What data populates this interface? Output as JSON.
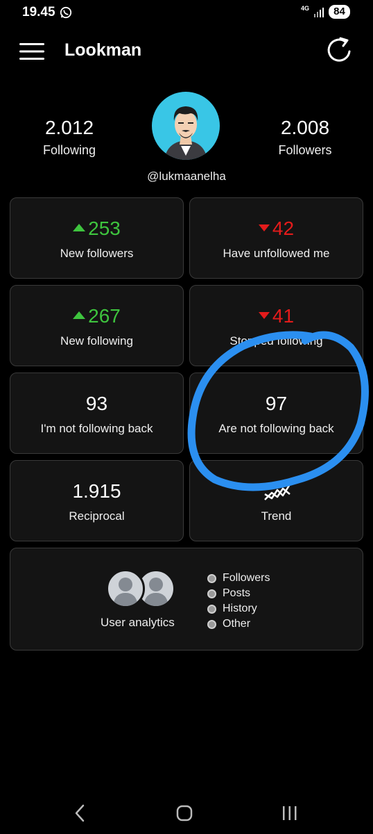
{
  "status_bar": {
    "time": "19.45",
    "network": "4G",
    "battery": "84",
    "icons": [
      "whatsapp-icon",
      "signal-icon"
    ]
  },
  "app_bar": {
    "title": "Lookman",
    "icons": [
      "menu-icon",
      "refresh-icon"
    ]
  },
  "profile": {
    "following_count": "2.012",
    "following_label": "Following",
    "followers_count": "2.008",
    "followers_label": "Followers",
    "username": "@lukmaanelha"
  },
  "cards": [
    {
      "value": "253",
      "label": "New followers",
      "trend": "up"
    },
    {
      "value": "42",
      "label": "Have unfollowed me",
      "trend": "down"
    },
    {
      "value": "267",
      "label": "New following",
      "trend": "up"
    },
    {
      "value": "41",
      "label": "Stopped following",
      "trend": "down"
    },
    {
      "value": "93",
      "label": "I'm not following back"
    },
    {
      "value": "97",
      "label": "Are not following back"
    },
    {
      "value": "1.915",
      "label": "Reciprocal"
    },
    {
      "label": "Trend",
      "icon": "trend-chart-icon"
    }
  ],
  "user_analytics": {
    "label": "User analytics",
    "items": [
      "Followers",
      "Posts",
      "History",
      "Other"
    ]
  },
  "colors": {
    "background": "#000000",
    "card": "#141414",
    "up": "#3ec43e",
    "down": "#e31b1b",
    "avatar_bg": "#39c6e6",
    "annotation": "#2b8ff0"
  },
  "nav_bar": {
    "icons": [
      "back-icon",
      "home-icon",
      "recents-icon"
    ]
  }
}
